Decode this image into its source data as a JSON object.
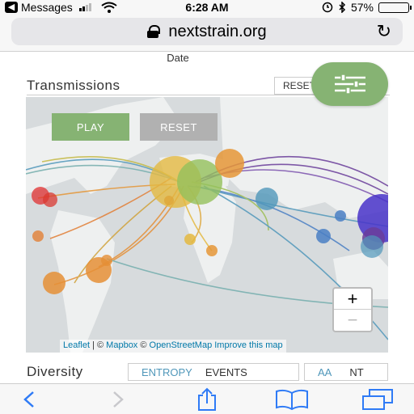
{
  "status_bar": {
    "back_app": "Messages",
    "time": "6:28 AM",
    "battery_percent": "57%",
    "battery_level": 0.57,
    "signal_bars": 2
  },
  "browser": {
    "url": "nextstrain.org"
  },
  "page": {
    "date_label": "Date",
    "transmissions": {
      "title": "Transmissions",
      "reset_label": "RESET"
    },
    "map": {
      "play_label": "PLAY",
      "reset_label": "RESET",
      "zoom_in": "+",
      "zoom_out": "−",
      "attribution": {
        "leaflet": "Leaflet",
        "sep": " | © ",
        "mapbox": "Mapbox",
        "copy": " © ",
        "osm": "OpenStreetMap",
        "improve": "Improve this map"
      }
    },
    "diversity": {
      "title": "Diversity",
      "tabs": [
        "ENTROPY",
        "EVENTS"
      ],
      "tabs2": [
        "AA",
        "NT"
      ]
    }
  },
  "colors": {
    "accent_green": "#86b373",
    "link_blue": "#0078a8",
    "ios_blue": "#2f7bf6"
  },
  "icons": [
    "lock-icon",
    "reload-icon",
    "settings-sliders-icon",
    "back-icon",
    "forward-icon",
    "share-icon",
    "bookmarks-icon",
    "tabs-icon",
    "wifi-icon",
    "bluetooth-icon",
    "alarm-icon"
  ]
}
